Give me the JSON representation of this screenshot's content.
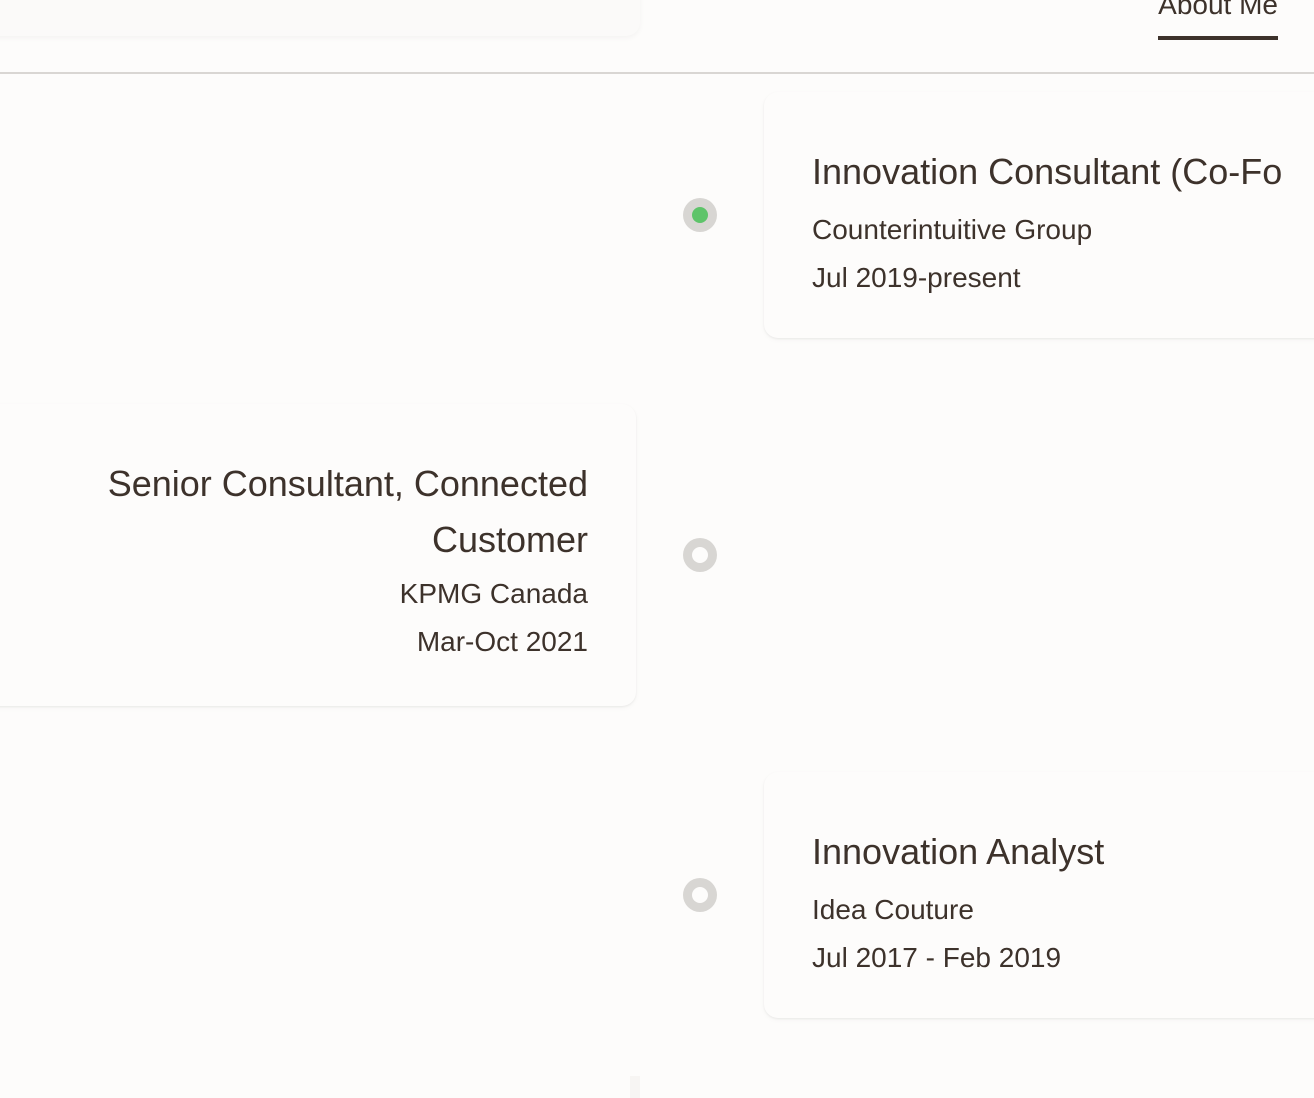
{
  "header": {
    "nav_about": "About Me"
  },
  "timeline": {
    "entries": [
      {
        "title": "Innovation Consultant (Co-Fo",
        "company": "Counterintuitive Group",
        "dates": "Jul 2019-present",
        "side": "right",
        "current": true
      },
      {
        "title": "Senior Consultant, Connected Customer",
        "company": "KPMG Canada",
        "dates": "Mar-Oct 2021",
        "side": "left",
        "current": false
      },
      {
        "title": "Innovation Analyst",
        "company": "Idea Couture",
        "dates": "Jul 2017 - Feb 2019",
        "side": "right",
        "current": false
      }
    ]
  },
  "colors": {
    "text": "#3d322b",
    "background": "#fdfcfb",
    "dot_ring": "#d8d6d3",
    "active_dot": "#5ec46a"
  }
}
